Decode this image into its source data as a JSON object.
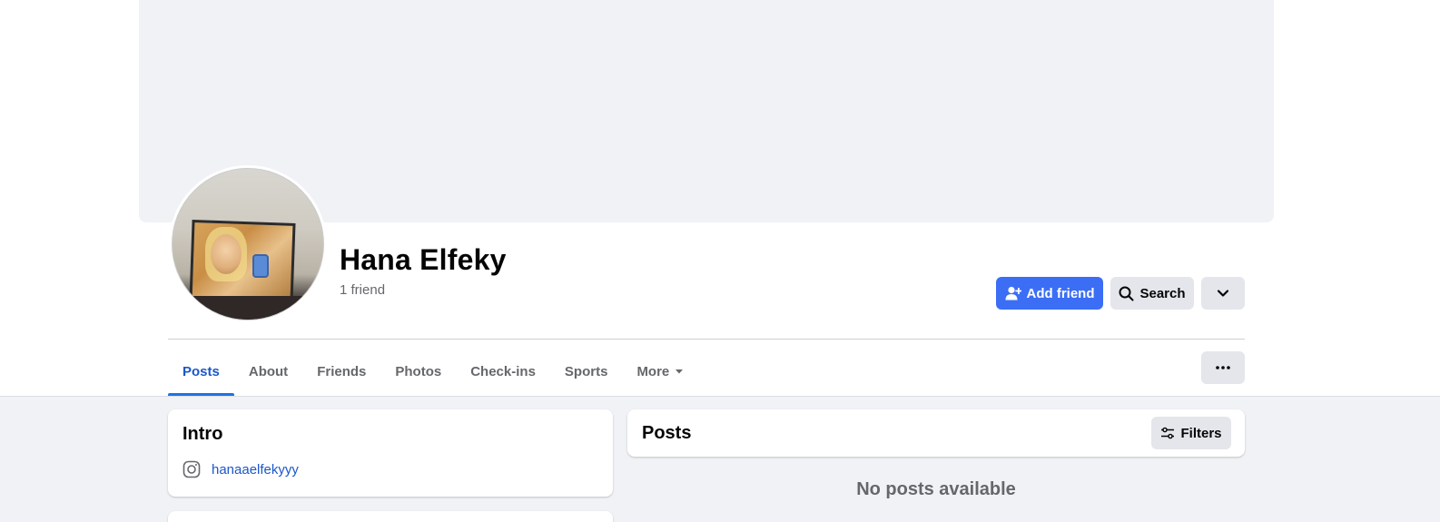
{
  "profile": {
    "name": "Hana Elfeky",
    "friend_count": "1 friend"
  },
  "actions": {
    "add_friend_label": "Add friend",
    "search_label": "Search"
  },
  "tabs": [
    {
      "label": "Posts",
      "active": true
    },
    {
      "label": "About"
    },
    {
      "label": "Friends"
    },
    {
      "label": "Photos"
    },
    {
      "label": "Check-ins"
    },
    {
      "label": "Sports"
    },
    {
      "label": "More"
    }
  ],
  "intro": {
    "title": "Intro",
    "instagram_handle": "hanaaelfekyyy"
  },
  "posts": {
    "title": "Posts",
    "filters_label": "Filters",
    "empty_message": "No posts available"
  },
  "colors": {
    "accent": "#1b74e4",
    "link": "#1b57c9",
    "button_gray": "#e4e6eb",
    "page_bg": "#f0f2f5"
  }
}
